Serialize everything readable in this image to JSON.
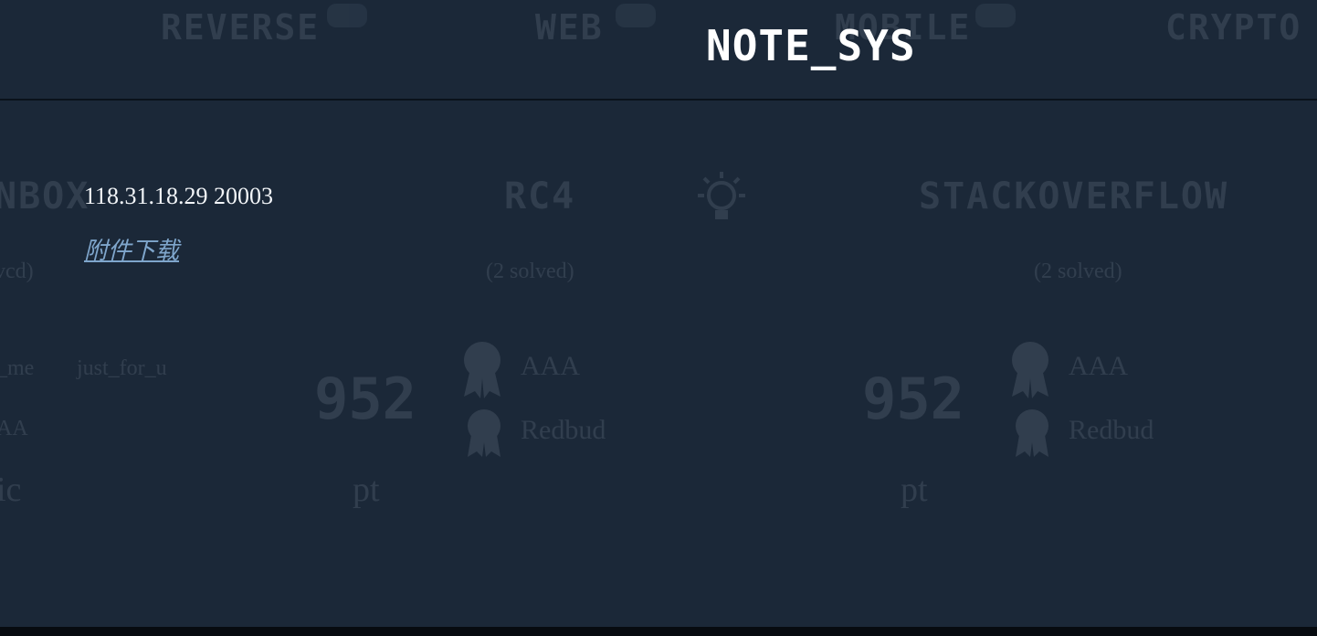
{
  "modal": {
    "title": "NOTE_SYS",
    "endpoint": "118.31.18.29 20003",
    "attachment_link": "附件下载"
  },
  "background": {
    "categories": [
      {
        "name": "REVERSE"
      },
      {
        "name": "WEB"
      },
      {
        "name": "MOBILE"
      },
      {
        "name": "CRYPTO"
      }
    ],
    "challenges": [
      {
        "title": "NBOX",
        "solved": "vcd)",
        "points": "",
        "pt": "ic"
      },
      {
        "title": "RC4",
        "solved": "(2 solved)",
        "points": "952",
        "pt": "pt"
      },
      {
        "title": "STACKOVERFLOW",
        "solved": "(2 solved)",
        "points": "952",
        "pt": "pt"
      }
    ],
    "solvers": [
      "AAA",
      "Redbud"
    ],
    "left_fragments": [
      "_me",
      "just_for_u",
      "AA"
    ]
  },
  "colors": {
    "background": "#1b2838",
    "link": "#7fa6cc",
    "title": "#ffffff"
  }
}
